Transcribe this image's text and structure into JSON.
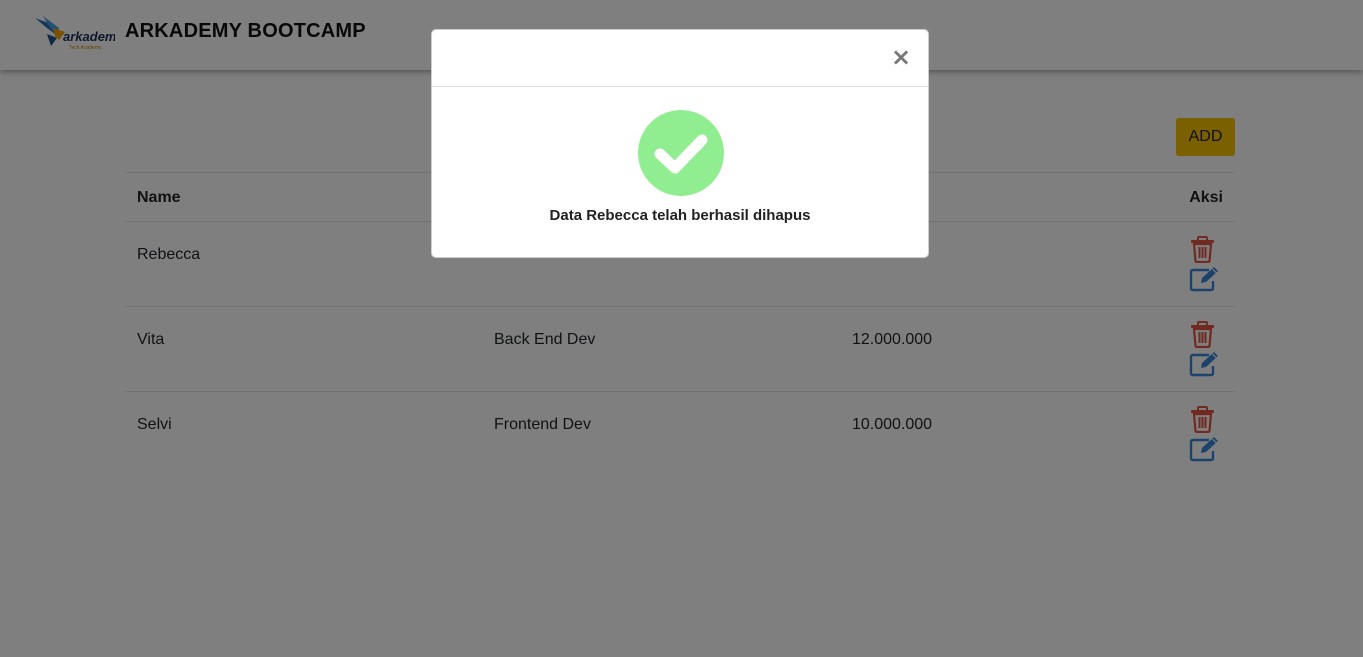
{
  "navbar": {
    "brand_title": "ARKADEMY BOOTCAMP",
    "logo_text": "arkademy",
    "logo_subtext": "Tech Academy"
  },
  "toolbar": {
    "add_label": "ADD"
  },
  "table": {
    "headers": {
      "name": "Name",
      "job": "",
      "salary": "",
      "aksi": "Aksi"
    },
    "rows": [
      {
        "name": "Rebecca",
        "job": "",
        "salary": ""
      },
      {
        "name": "Vita",
        "job": "Back End Dev",
        "salary": "12.000.000"
      },
      {
        "name": "Selvi",
        "job": "Frontend Dev",
        "salary": "10.000.000"
      }
    ]
  },
  "modal": {
    "close_label": "×",
    "message": "Data Rebecca telah berhasil dihapus"
  },
  "colors": {
    "accent_yellow": "#f5c000",
    "delete_red": "#e05545",
    "edit_blue": "#3a86d8",
    "success_green": "#90ee90"
  },
  "icons": [
    "logo-icon",
    "trash-icon",
    "edit-icon",
    "close-icon",
    "success-check-icon"
  ]
}
